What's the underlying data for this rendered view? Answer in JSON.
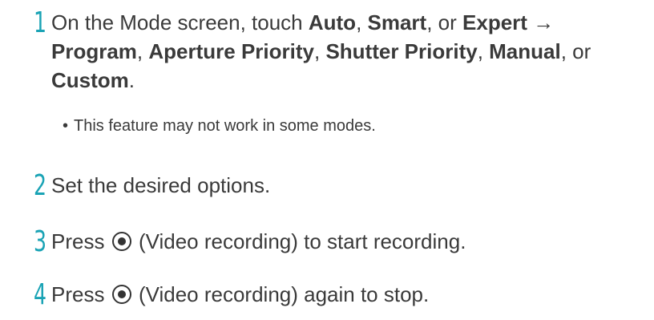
{
  "steps": [
    {
      "number": "1",
      "line1": {
        "t1": "On the Mode screen, touch ",
        "b1": "Auto",
        "t2": ", ",
        "b2": "Smart",
        "t3": ", or ",
        "b3": "Expert",
        "t4": " →"
      },
      "line2": {
        "b1": "Program",
        "t1": ", ",
        "b2": "Aperture Priority",
        "t2": ", ",
        "b3": "Shutter Priority",
        "t3": ", ",
        "b4": "Manual",
        "t4": ", or"
      },
      "line3": {
        "b1": "Custom",
        "t1": "."
      },
      "note": "This feature may not work in some modes."
    },
    {
      "number": "2",
      "text": "Set the desired options."
    },
    {
      "number": "3",
      "before": "Press",
      "icon": "video-record-icon",
      "after": "(Video recording) to start recording."
    },
    {
      "number": "4",
      "before": "Press",
      "icon": "video-record-icon",
      "after": "(Video recording) again to stop."
    }
  ],
  "colors": {
    "step_number": "#1aa3b5",
    "text": "#3a3a3a"
  }
}
